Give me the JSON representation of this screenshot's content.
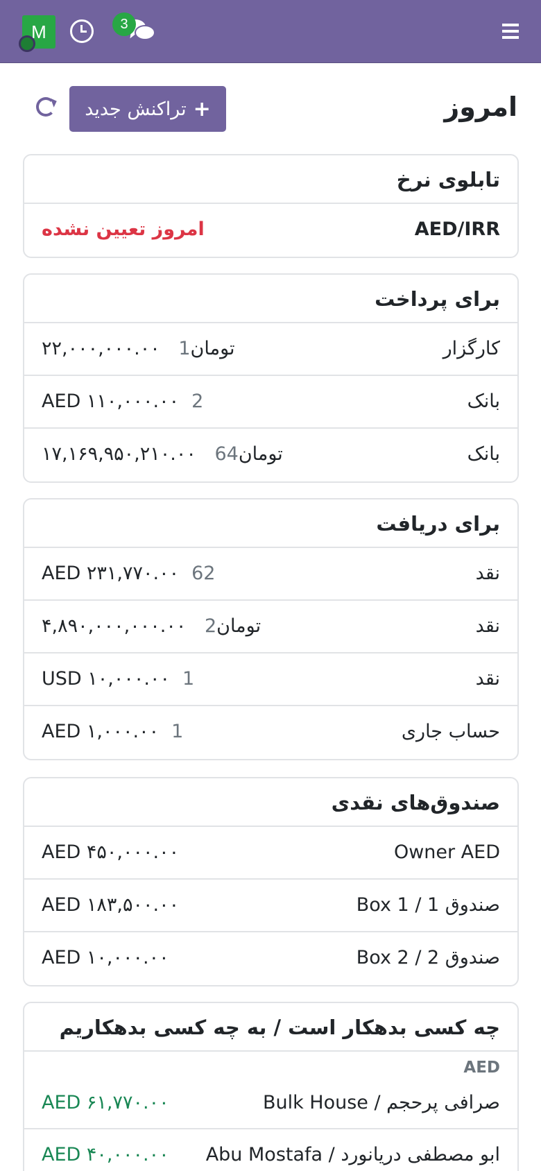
{
  "header": {
    "avatar_letter": "M",
    "chat_badge": "3",
    "icons": [
      "user-avatar",
      "clock-icon",
      "chat-icon",
      "menu-icon"
    ],
    "bar_color": "#71639e"
  },
  "page": {
    "title": "امروز",
    "new_transaction": "تراکنش جدید"
  },
  "rates": {
    "title": "تابلوی نرخ",
    "pair": "AED/IRR",
    "status": "امروز تعیین نشده"
  },
  "payables": {
    "title": "برای پرداخت",
    "rows": [
      {
        "label": "کارگزار",
        "count": "1",
        "amount": "۲۲,۰۰۰,۰۰۰.۰۰ تومان"
      },
      {
        "label": "بانک",
        "count": "2",
        "amount": "AED ۱۱۰,۰۰۰.۰۰"
      },
      {
        "label": "بانک",
        "count": "64",
        "amount": "۱۷,۱۶۹,۹۵۰,۲۱۰.۰۰ تومان"
      }
    ]
  },
  "receivables": {
    "title": "برای دریافت",
    "rows": [
      {
        "label": "نقد",
        "count": "62",
        "amount": "AED ۲۳۱,۷۷۰.۰۰"
      },
      {
        "label": "نقد",
        "count": "2",
        "amount": "۴,۸۹۰,۰۰۰,۰۰۰.۰۰ تومان"
      },
      {
        "label": "نقد",
        "count": "1",
        "amount": "USD ۱۰,۰۰۰.۰۰"
      },
      {
        "label": "حساب جاری",
        "count": "1",
        "amount": "AED ۱,۰۰۰.۰۰"
      }
    ]
  },
  "cashboxes": {
    "title": "صندوق‌های نقدی",
    "rows": [
      {
        "label": "Owner AED",
        "amount": "AED ۴۵۰,۰۰۰.۰۰"
      },
      {
        "label": "صندوق Box 1 / 1",
        "amount": "AED ۱۸۳,۵۰۰.۰۰"
      },
      {
        "label": "صندوق Box 2 / 2",
        "amount": "AED ۱۰,۰۰۰.۰۰"
      }
    ]
  },
  "debts": {
    "title": "چه کسی بدهکار است / به چه کسی بدهکاریم",
    "group": "AED",
    "rows": [
      {
        "label": "صرافی پرحجم / Bulk House",
        "amount": "AED ۶۱,۷۷۰.۰۰"
      },
      {
        "label": "ابو مصطفی دریانورد / Abu Mostafa",
        "amount": "AED ۴۰,۰۰۰.۰۰"
      }
    ],
    "positive_color": "#198754"
  }
}
